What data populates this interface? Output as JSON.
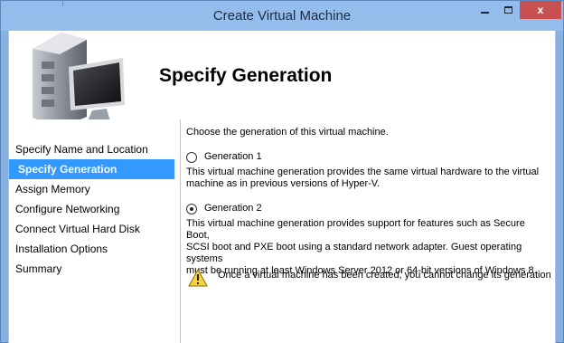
{
  "window": {
    "title": "Create Virtual Machine",
    "close_glyph": "x"
  },
  "header": {
    "title": "Specify Generation",
    "icon": "server-computer-icon"
  },
  "nav": {
    "items": [
      {
        "label": "Specify Name and Location",
        "selected": false
      },
      {
        "label": "Specify Generation",
        "selected": true
      },
      {
        "label": "Assign Memory",
        "selected": false
      },
      {
        "label": "Configure Networking",
        "selected": false
      },
      {
        "label": "Connect Virtual Hard Disk",
        "selected": false
      },
      {
        "label": "Installation Options",
        "selected": false
      },
      {
        "label": "Summary",
        "selected": false
      }
    ]
  },
  "content": {
    "intro": "Choose the generation of this virtual machine.",
    "options": [
      {
        "label": "Generation 1",
        "checked": false,
        "description_lines": [
          "This virtual machine generation provides the same virtual hardware to the virtual",
          "machine as in previous versions of Hyper-V."
        ]
      },
      {
        "label": "Generation 2",
        "checked": true,
        "description_lines": [
          "This virtual machine generation provides support for features such as Secure Boot,",
          "SCSI boot and PXE boot using a standard network adapter. Guest operating systems",
          "must be running at least Windows Server 2012 or 64-bit versions of Windows 8."
        ]
      }
    ],
    "warning": "Once a virtual machine has been created, you cannot change its generation"
  },
  "colors": {
    "titlebar": "#95bdec",
    "selection": "#3399ff",
    "close_button": "#c75050"
  }
}
